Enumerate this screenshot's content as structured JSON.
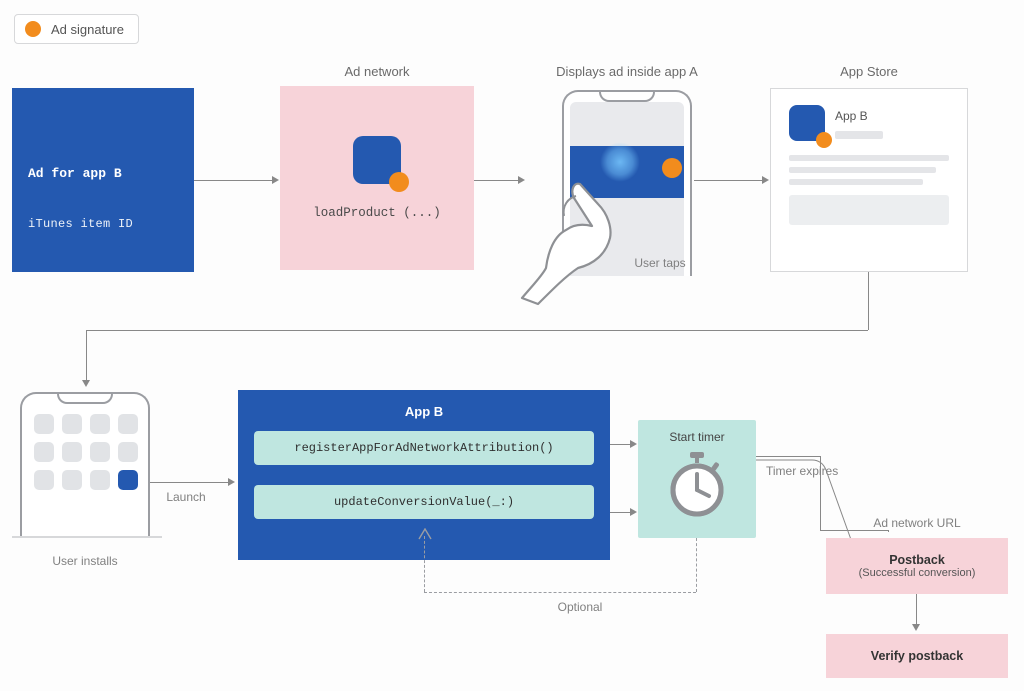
{
  "legend": {
    "label": "Ad signature"
  },
  "top_labels": {
    "ad_network": "Ad network",
    "displays_ad": "Displays ad inside app A",
    "app_store": "App Store"
  },
  "ad_panel": {
    "title": "Ad for app B",
    "subtitle": "iTunes item ID"
  },
  "ad_network": {
    "method": "loadProduct (...)"
  },
  "display_ad": {
    "caption": "User taps"
  },
  "store": {
    "app_name": "App B"
  },
  "install": {
    "caption": "User installs",
    "arrow_label": "Launch"
  },
  "app_b_panel": {
    "title": "App B",
    "method1": "registerAppForAdNetworkAttribution()",
    "method2": "updateConversionValue(_:)"
  },
  "timer": {
    "label": "Start timer",
    "expires": "Timer expires"
  },
  "optional_label": "Optional",
  "postback": {
    "header": "Ad network URL",
    "title": "Postback",
    "subtitle": "(Successful conversion)"
  },
  "verify": {
    "label": "Verify postback"
  }
}
